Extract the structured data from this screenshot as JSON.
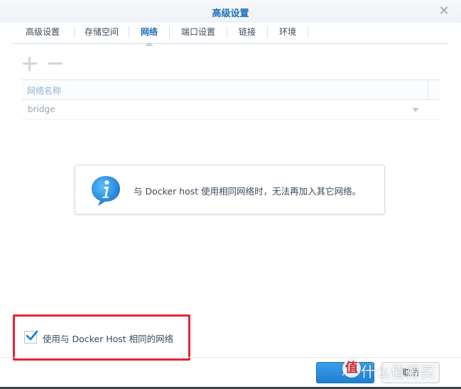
{
  "window": {
    "title": "高级设置",
    "close_icon": "close-icon"
  },
  "tabs": [
    {
      "label": "高级设置",
      "active": false
    },
    {
      "label": "存储空间",
      "active": false
    },
    {
      "label": "网络",
      "active": true
    },
    {
      "label": "端口设置",
      "active": false
    },
    {
      "label": "链接",
      "active": false
    },
    {
      "label": "环境",
      "active": false
    }
  ],
  "toolbar": {
    "add_icon": "plus-icon",
    "remove_icon": "minus-icon"
  },
  "table": {
    "columns": [
      "网络名称"
    ],
    "rows": [
      {
        "name": "bridge"
      }
    ]
  },
  "info": {
    "icon": "info-icon",
    "message": "与 Docker host 使用相同网络时，无法再加入其它网络。"
  },
  "checkbox": {
    "label": "使用与 Docker Host 相同的网络",
    "checked": true
  },
  "footer": {
    "apply_label": "A",
    "cancel_label": "取消"
  },
  "watermark": {
    "logo": "值",
    "text": "什么值得买"
  },
  "colors": {
    "accent": "#1d6fb8",
    "highlight": "#e8232f",
    "info_blue": "#1a8ee0"
  }
}
